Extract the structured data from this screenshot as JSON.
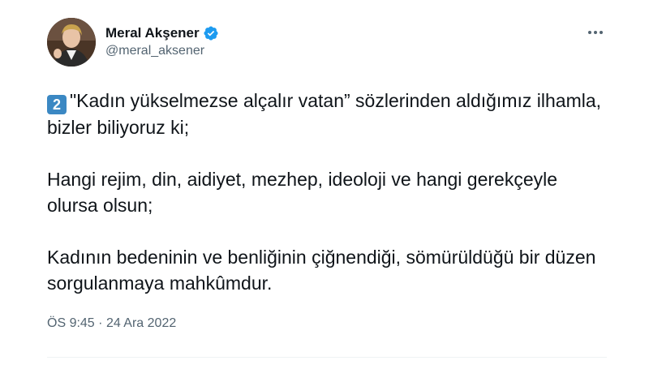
{
  "author": {
    "display_name": "Meral Akşener",
    "handle": "@meral_aksener",
    "verified": true,
    "verified_color": "#1d9bf0"
  },
  "tweet": {
    "keycap": "2",
    "keycap_color": "#3b88c3",
    "lines": [
      "\"Kadın yükselmezse alçalır vatan” sözlerinden aldığımız ilhamla, bizler biliyoruz ki;",
      "Hangi rejim, din, aidiyet, mezhep, ideoloji ve hangi gerekçeyle olursa olsun;",
      "Kadının bedeninin ve benliğinin çiğnendiği, sömürüldüğü bir düzen sorgulanmaya mahkûmdur."
    ],
    "time": "ÖS 9:45",
    "separator": "·",
    "date": "24 Ara 2022"
  },
  "icons": {
    "more": "more-horizontal-icon",
    "verified": "verified-badge-icon"
  }
}
